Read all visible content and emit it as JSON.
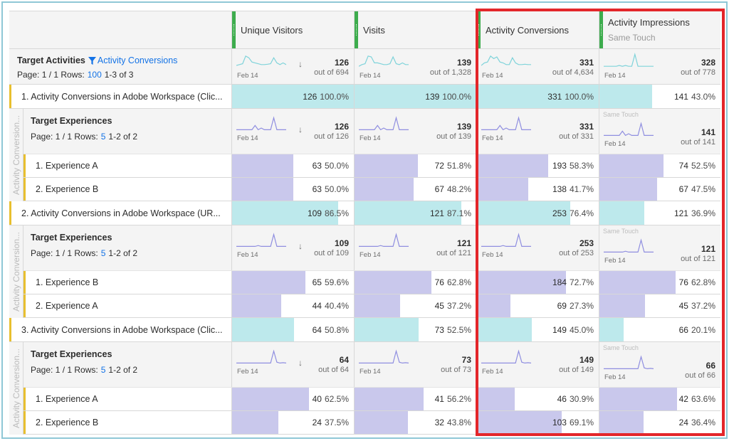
{
  "columns": [
    {
      "title": "Unique Visitors",
      "subtitle": ""
    },
    {
      "title": "Visits",
      "subtitle": ""
    },
    {
      "title": "Activity Conversions",
      "subtitle": ""
    },
    {
      "title": "Activity Impressions",
      "subtitle": "Same Touch"
    }
  ],
  "totals": {
    "title": "Target Activities",
    "filter_label": "Activity Conversions",
    "pager": {
      "page_label": "Page: 1 / 1 Rows:",
      "rows": "100",
      "range": "1-3 of 3"
    },
    "date_label": "Feb 14",
    "cells": [
      {
        "value": "126",
        "outof": "out of 694",
        "sort": "↓"
      },
      {
        "value": "139",
        "outof": "out of 1,328"
      },
      {
        "value": "331",
        "outof": "out of 4,634"
      },
      {
        "value": "328",
        "outof": "out of 778"
      }
    ],
    "spark_color": "#7fd3da"
  },
  "breakdown_label": "Activity Conversion...",
  "activities": [
    {
      "label": "1. Activity Conversions in Adobe Workspace (Clic...",
      "cells": [
        {
          "value": "126",
          "pct": "100.0%",
          "fill": 1.0
        },
        {
          "value": "139",
          "pct": "100.0%",
          "fill": 1.0
        },
        {
          "value": "331",
          "pct": "100.0%",
          "fill": 1.0
        },
        {
          "value": "141",
          "pct": "43.0%",
          "fill": 0.43
        }
      ],
      "sub": {
        "title": "Target Experiences",
        "pager": {
          "page_label": "Page: 1 / 1 Rows:",
          "rows": "5",
          "range": "1-2 of 2"
        },
        "cells": [
          {
            "value": "126",
            "outof": "out of 126",
            "sort": "↓"
          },
          {
            "value": "139",
            "outof": "out of 139"
          },
          {
            "value": "331",
            "outof": "out of 331"
          },
          {
            "value": "141",
            "outof": "out of 141",
            "note": "Same Touch"
          }
        ],
        "items": [
          {
            "label": "1. Experience A",
            "cells": [
              {
                "value": "63",
                "pct": "50.0%",
                "fill": 0.5
              },
              {
                "value": "72",
                "pct": "51.8%",
                "fill": 0.518
              },
              {
                "value": "193",
                "pct": "58.3%",
                "fill": 0.583
              },
              {
                "value": "74",
                "pct": "52.5%",
                "fill": 0.525
              }
            ]
          },
          {
            "label": "2. Experience B",
            "cells": [
              {
                "value": "63",
                "pct": "50.0%",
                "fill": 0.5
              },
              {
                "value": "67",
                "pct": "48.2%",
                "fill": 0.482
              },
              {
                "value": "138",
                "pct": "41.7%",
                "fill": 0.417
              },
              {
                "value": "67",
                "pct": "47.5%",
                "fill": 0.475
              }
            ]
          }
        ]
      }
    },
    {
      "label": "2. Activity Conversions in Adobe Workspace (UR...",
      "cells": [
        {
          "value": "109",
          "pct": "86.5%",
          "fill": 0.865
        },
        {
          "value": "121",
          "pct": "87.1%",
          "fill": 0.871
        },
        {
          "value": "253",
          "pct": "76.4%",
          "fill": 0.764
        },
        {
          "value": "121",
          "pct": "36.9%",
          "fill": 0.369
        }
      ],
      "sub": {
        "title": "Target Experiences",
        "pager": {
          "page_label": "Page: 1 / 1 Rows:",
          "rows": "5",
          "range": "1-2 of 2"
        },
        "cells": [
          {
            "value": "109",
            "outof": "out of 109",
            "sort": "↓"
          },
          {
            "value": "121",
            "outof": "out of 121"
          },
          {
            "value": "253",
            "outof": "out of 253"
          },
          {
            "value": "121",
            "outof": "out of 121",
            "note": "Same Touch"
          }
        ],
        "items": [
          {
            "label": "1. Experience B",
            "cells": [
              {
                "value": "65",
                "pct": "59.6%",
                "fill": 0.596
              },
              {
                "value": "76",
                "pct": "62.8%",
                "fill": 0.628
              },
              {
                "value": "184",
                "pct": "72.7%",
                "fill": 0.727
              },
              {
                "value": "76",
                "pct": "62.8%",
                "fill": 0.628
              }
            ]
          },
          {
            "label": "2. Experience A",
            "cells": [
              {
                "value": "44",
                "pct": "40.4%",
                "fill": 0.404
              },
              {
                "value": "45",
                "pct": "37.2%",
                "fill": 0.372
              },
              {
                "value": "69",
                "pct": "27.3%",
                "fill": 0.273
              },
              {
                "value": "45",
                "pct": "37.2%",
                "fill": 0.372
              }
            ]
          }
        ]
      }
    },
    {
      "label": "3. Activity Conversions in Adobe Workspace (Clic...",
      "cells": [
        {
          "value": "64",
          "pct": "50.8%",
          "fill": 0.508
        },
        {
          "value": "73",
          "pct": "52.5%",
          "fill": 0.525
        },
        {
          "value": "149",
          "pct": "45.0%",
          "fill": 0.45
        },
        {
          "value": "66",
          "pct": "20.1%",
          "fill": 0.201
        }
      ],
      "sub": {
        "title": "Target Experiences",
        "pager": {
          "page_label": "Page: 1 / 1 Rows:",
          "rows": "5",
          "range": "1-2 of 2"
        },
        "cells": [
          {
            "value": "64",
            "outof": "out of 64",
            "sort": "↓"
          },
          {
            "value": "73",
            "outof": "out of 73"
          },
          {
            "value": "149",
            "outof": "out of 149"
          },
          {
            "value": "66",
            "outof": "out of 66",
            "note": "Same Touch"
          }
        ],
        "items": [
          {
            "label": "1. Experience A",
            "cells": [
              {
                "value": "40",
                "pct": "62.5%",
                "fill": 0.625
              },
              {
                "value": "41",
                "pct": "56.2%",
                "fill": 0.562
              },
              {
                "value": "46",
                "pct": "30.9%",
                "fill": 0.309
              },
              {
                "value": "42",
                "pct": "63.6%",
                "fill": 0.636
              }
            ]
          },
          {
            "label": "2. Experience B",
            "cells": [
              {
                "value": "24",
                "pct": "37.5%",
                "fill": 0.375
              },
              {
                "value": "32",
                "pct": "43.8%",
                "fill": 0.438
              },
              {
                "value": "103",
                "pct": "69.1%",
                "fill": 0.691
              },
              {
                "value": "24",
                "pct": "36.4%",
                "fill": 0.364
              }
            ]
          }
        ]
      }
    }
  ],
  "colors": {
    "teal_bar": "#bde9ec",
    "purple_bar": "#c9c8ec",
    "spark_teal": "#7fd3da",
    "spark_purple": "#8f8ee0",
    "accent": "#1473e6",
    "highlight": "#e3262a",
    "column_grip": "#3dac4d",
    "row_marker": "#e8bf2f"
  }
}
